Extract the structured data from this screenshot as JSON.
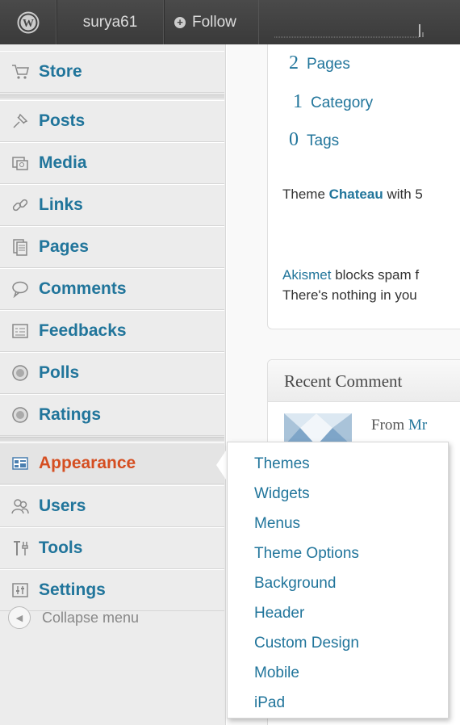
{
  "adminbar": {
    "user": "surya61",
    "follow": "Follow"
  },
  "sidebar": {
    "items": [
      {
        "label": "Store",
        "icon": "cart-icon"
      },
      {
        "label": "Posts",
        "icon": "pin-icon"
      },
      {
        "label": "Media",
        "icon": "media-icon"
      },
      {
        "label": "Links",
        "icon": "link-icon"
      },
      {
        "label": "Pages",
        "icon": "pages-icon"
      },
      {
        "label": "Comments",
        "icon": "comment-icon"
      },
      {
        "label": "Feedbacks",
        "icon": "feedback-icon"
      },
      {
        "label": "Polls",
        "icon": "poll-icon"
      },
      {
        "label": "Ratings",
        "icon": "rating-icon"
      },
      {
        "label": "Appearance",
        "icon": "appearance-icon"
      },
      {
        "label": "Users",
        "icon": "users-icon"
      },
      {
        "label": "Tools",
        "icon": "tools-icon"
      },
      {
        "label": "Settings",
        "icon": "settings-icon"
      }
    ],
    "collapse": "Collapse menu"
  },
  "right_now": {
    "pages_count": "2",
    "pages_label": "Pages",
    "category_count": "1",
    "category_label": "Category",
    "tags_count": "0",
    "tags_label": "Tags",
    "theme_prefix": "Theme ",
    "theme_name": "Chateau",
    "theme_suffix": " with 5",
    "akismet_link": "Akismet",
    "akismet_text": " blocks spam f",
    "nothing_text": "There's nothing in you"
  },
  "recent_comments": {
    "title": "Recent Comment",
    "from_prefix": "From ",
    "from_name": "Mr"
  },
  "appearance_submenu": [
    "Themes",
    "Widgets",
    "Menus",
    "Theme Options",
    "Background",
    "Header",
    "Custom Design",
    "Mobile",
    "iPad"
  ],
  "colors": {
    "link": "#21759b",
    "active": "#d54e21",
    "adminbar": "#464646"
  }
}
